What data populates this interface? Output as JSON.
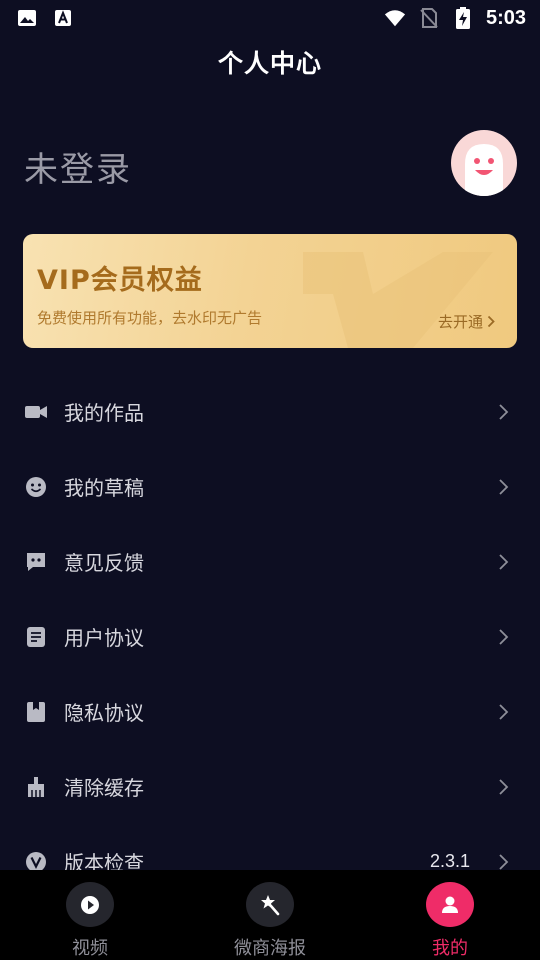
{
  "status_bar": {
    "time": "5:03",
    "left_icons": [
      "gallery-icon",
      "font-download-icon"
    ],
    "right_icons": [
      "wifi-icon",
      "no-sim-icon",
      "battery-charging-icon"
    ]
  },
  "header": {
    "title": "个人中心"
  },
  "profile": {
    "login_status": "未登录",
    "avatar_icon": "default-face-avatar-icon"
  },
  "vip_card": {
    "title": "VIP会员权益",
    "subtitle": "免费使用所有功能，去水印无广告",
    "action_label": "去开通",
    "colors": {
      "gradient_start": "#f8e2b2",
      "gradient_end": "#f0c97f",
      "text": "#a56b1c"
    }
  },
  "menu": {
    "items": [
      {
        "label": "我的作品",
        "icon": "video-camera-icon",
        "value": ""
      },
      {
        "label": "我的草稿",
        "icon": "smiley-icon",
        "value": ""
      },
      {
        "label": "意见反馈",
        "icon": "chat-bubble-icon",
        "value": ""
      },
      {
        "label": "用户协议",
        "icon": "document-icon",
        "value": ""
      },
      {
        "label": "隐私协议",
        "icon": "bookmark-icon",
        "value": ""
      },
      {
        "label": "清除缓存",
        "icon": "broom-icon",
        "value": ""
      },
      {
        "label": "版本检查",
        "icon": "version-v-icon",
        "value": "2.3.1"
      }
    ]
  },
  "bottom_nav": {
    "active_index": 2,
    "active_color": "#ef2c68",
    "items": [
      {
        "label": "视频",
        "icon": "play-icon"
      },
      {
        "label": "微商海报",
        "icon": "magic-wand-icon"
      },
      {
        "label": "我的",
        "icon": "person-icon"
      }
    ]
  },
  "colors": {
    "background": "#0d0e22",
    "nav_background": "#000000"
  }
}
